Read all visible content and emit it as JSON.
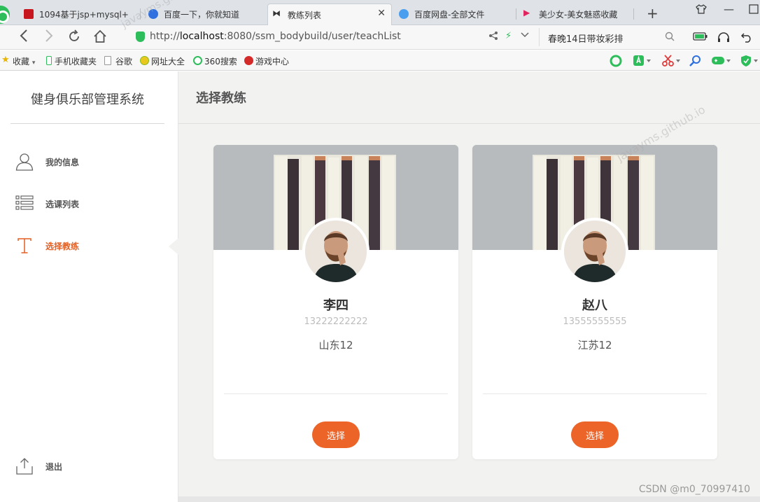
{
  "browser": {
    "tabs": [
      {
        "label": "1094基于jsp+mysql+",
        "active": false
      },
      {
        "label": "百度一下，你就知道",
        "active": false
      },
      {
        "label": "教练列表",
        "active": true
      },
      {
        "label": "百度网盘-全部文件",
        "active": false
      },
      {
        "label": "美少女-美女魅惑收藏",
        "active": false
      }
    ],
    "close_glyph": "✕",
    "new_tab_glyph": "+",
    "url_prefix": "http://",
    "url_host": "localhost",
    "url_rest": ":8080/ssm_bodybuild/user/teachList",
    "hot_search": "春晚14日带妆彩排",
    "bookmarks": [
      {
        "label": "收藏",
        "icon": "star-icon"
      },
      {
        "label": "手机收藏夹",
        "icon": "phone-icon"
      },
      {
        "label": "谷歌",
        "icon": "page-icon"
      },
      {
        "label": "网址大全",
        "icon": "compass-icon"
      },
      {
        "label": "360搜索",
        "icon": "search360-icon"
      },
      {
        "label": "游戏中心",
        "icon": "game-icon"
      }
    ]
  },
  "sidebar": {
    "title": "健身俱乐部管理系统",
    "items": [
      {
        "label": "我的信息",
        "icon": "user-icon"
      },
      {
        "label": "选课列表",
        "icon": "list-icon"
      },
      {
        "label": "选择教练",
        "icon": "text-t-icon",
        "active": true
      }
    ],
    "logout": {
      "label": "退出",
      "icon": "upload-exit-icon"
    }
  },
  "main": {
    "page_title": "选择教练",
    "coaches": [
      {
        "name": "李四",
        "phone": "13222222222",
        "address": "山东12",
        "button": "选择"
      },
      {
        "name": "赵八",
        "phone": "13555555555",
        "address": "江苏12",
        "button": "选择"
      }
    ]
  },
  "watermarks": {
    "site": "javayms.github.io",
    "site_short": "javayms.github",
    "csdn": "CSDN @m0_70997410"
  },
  "colors": {
    "accent": "#ec6428",
    "active_menu": "#e35f23",
    "page_bg": "#f2f2f0"
  }
}
